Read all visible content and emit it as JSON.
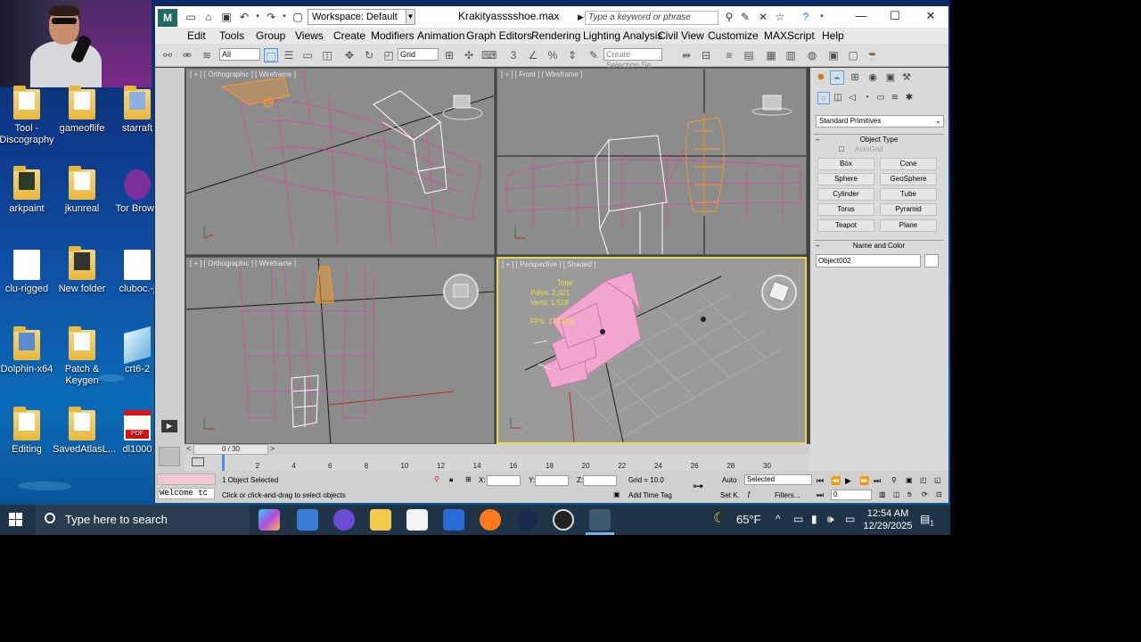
{
  "webcam": {
    "visible": true
  },
  "desktop_icons": [
    {
      "label": "Tool - Discography",
      "kind": "folder"
    },
    {
      "label": "gameoflife",
      "kind": "folder"
    },
    {
      "label": "starraft",
      "kind": "folder"
    },
    {
      "label": "arkpaint",
      "kind": "app"
    },
    {
      "label": "jkunreal",
      "kind": "folder"
    },
    {
      "label": "Tor Brows",
      "kind": "app"
    },
    {
      "label": "clu-rigged",
      "kind": "file"
    },
    {
      "label": "New folder",
      "kind": "folder"
    },
    {
      "label": "cluboc.-j",
      "kind": "file"
    },
    {
      "label": "Dolphin-x64",
      "kind": "folder"
    },
    {
      "label": "Patch & Keygen",
      "kind": "folder"
    },
    {
      "label": "crt6-2",
      "kind": "app"
    },
    {
      "label": "Editing",
      "kind": "folder"
    },
    {
      "label": "SavedAtlasL...",
      "kind": "folder"
    },
    {
      "label": "dl1000",
      "kind": "pdf"
    }
  ],
  "window": {
    "logo": "M",
    "workspace": "Workspace: Default",
    "title": "Krakityasssshoe.max",
    "search_placeholder": "Type a keyword or phrase",
    "controls": {
      "minimize": "—",
      "maximize": "☐",
      "close": "✕"
    }
  },
  "menu": [
    "Edit",
    "Tools",
    "Group",
    "Views",
    "Create",
    "Modifiers",
    "Animation",
    "Graph Editors",
    "Rendering",
    "Lighting Analysis",
    "Civil View",
    "Customize",
    "MAXScript",
    "Help"
  ],
  "toolbar": {
    "selection_filter": "All",
    "ref_coord": "Grid",
    "named_selection_placeholder": "Create Selection Se"
  },
  "viewports": {
    "top_left": {
      "label": "[ + ] [ Orthographic ] [ Wireframe ]"
    },
    "top_right": {
      "label": "[ + ] [ Front ] [ Wireframe ]"
    },
    "bottom_left": {
      "label": "[ + ] [ Orthographic ] [ Wireframe ]"
    },
    "bottom_right": {
      "label": "[ + ] [ Perspective ] [ Shaded ]",
      "stats": {
        "total_label": "Total",
        "polys_label": "Polys:",
        "polys": "2,021",
        "verts_label": "Verts:",
        "verts": "1,519",
        "fps_label": "FPS:",
        "fps": "170.882"
      }
    }
  },
  "command_panel": {
    "category": "Standard Primitives",
    "object_type_title": "Object Type",
    "autogrid": "AutoGrid",
    "buttons": [
      "Box",
      "Cone",
      "Sphere",
      "GeoSphere",
      "Cylinder",
      "Tube",
      "Torus",
      "Pyramid",
      "Teapot",
      "Plane"
    ],
    "name_color_title": "Name and Color",
    "object_name": "Object002"
  },
  "timeline": {
    "frame_display": "0 / 30",
    "ticks": [
      "0",
      "2",
      "4",
      "6",
      "8",
      "10",
      "12",
      "14",
      "16",
      "18",
      "20",
      "22",
      "24",
      "26",
      "28",
      "30"
    ]
  },
  "status": {
    "selected": "1 Object Selected",
    "prompt": "Click or click-and-drag to select objects",
    "maxscript": "Welcome tc",
    "x_label": "X:",
    "y_label": "Y:",
    "z_label": "Z:",
    "grid": "Grid = 10.0",
    "add_time_tag": "Add Time Tag",
    "auto": "Auto",
    "set_key": "Set K.",
    "key_filter": "Selected",
    "filters": "Filters...",
    "frame": "0"
  },
  "taskbar": {
    "search_placeholder": "Type here to search",
    "weather": "65°F",
    "time": "12:54 AM",
    "date": "12/29/2025",
    "notifications": "1"
  },
  "colors": {
    "viewport_bg": "#8c8c8c",
    "wire_pink": "#e2439f",
    "wire_orange": "#f2972f",
    "active_border": "#e8d84a",
    "taskbar": "#1f3447"
  }
}
